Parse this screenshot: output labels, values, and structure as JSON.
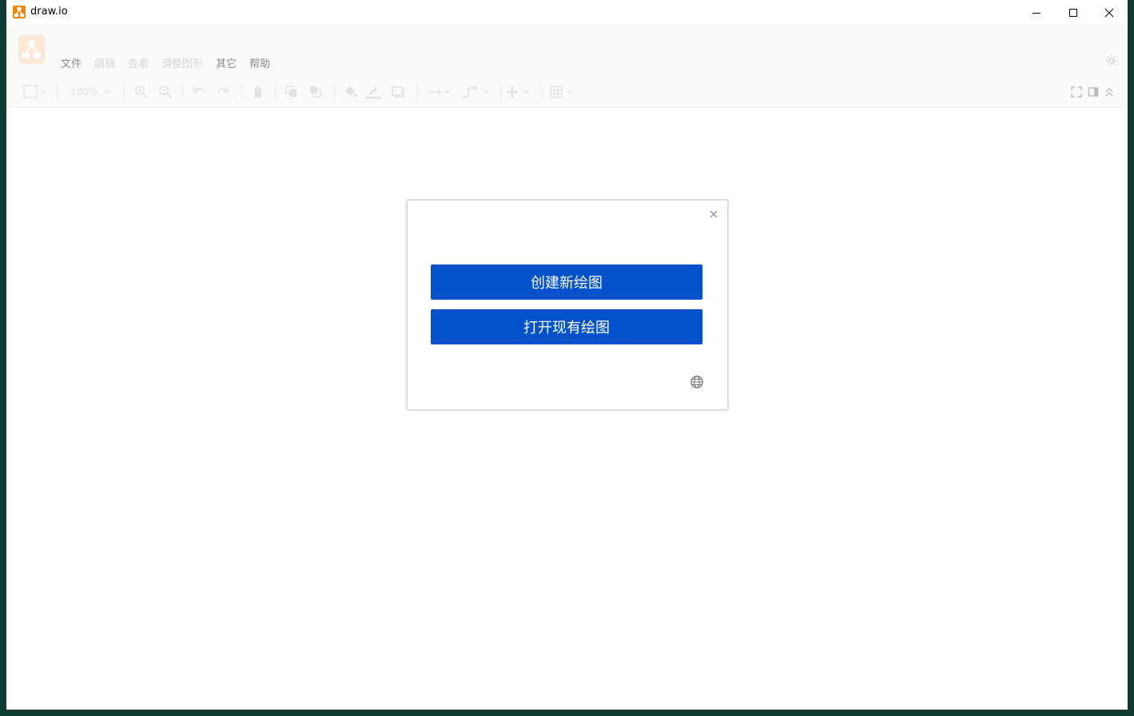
{
  "window": {
    "title": "draw.io"
  },
  "menubar": {
    "items": [
      {
        "label": "文件",
        "enabled": true
      },
      {
        "label": "编辑",
        "enabled": false
      },
      {
        "label": "查看",
        "enabled": false
      },
      {
        "label": "调整图形",
        "enabled": false
      },
      {
        "label": "其它",
        "enabled": true
      },
      {
        "label": "帮助",
        "enabled": true
      }
    ]
  },
  "toolbar": {
    "zoom_label": "100%"
  },
  "dialog": {
    "create_label": "创建新绘图",
    "open_label": "打开现有绘图"
  },
  "colors": {
    "primary_button": "#0352cc",
    "logo_orange": "#f08705",
    "desktop_bg": "#0f3d33"
  },
  "icons": [
    "drawio-app-icon",
    "minimize-icon",
    "maximize-icon",
    "close-icon",
    "drawio-logo-icon",
    "theme-sun-icon",
    "format-panel-icon",
    "zoom-in-icon",
    "zoom-out-icon",
    "undo-icon",
    "redo-icon",
    "delete-icon",
    "to-front-icon",
    "to-back-icon",
    "fill-color-icon",
    "line-color-icon",
    "shadow-icon",
    "connection-icon",
    "waypoint-icon",
    "insert-icon",
    "table-icon",
    "fullscreen-icon",
    "toggle-panel-icon",
    "collapse-icon",
    "dialog-close-icon",
    "globe-icon"
  ]
}
